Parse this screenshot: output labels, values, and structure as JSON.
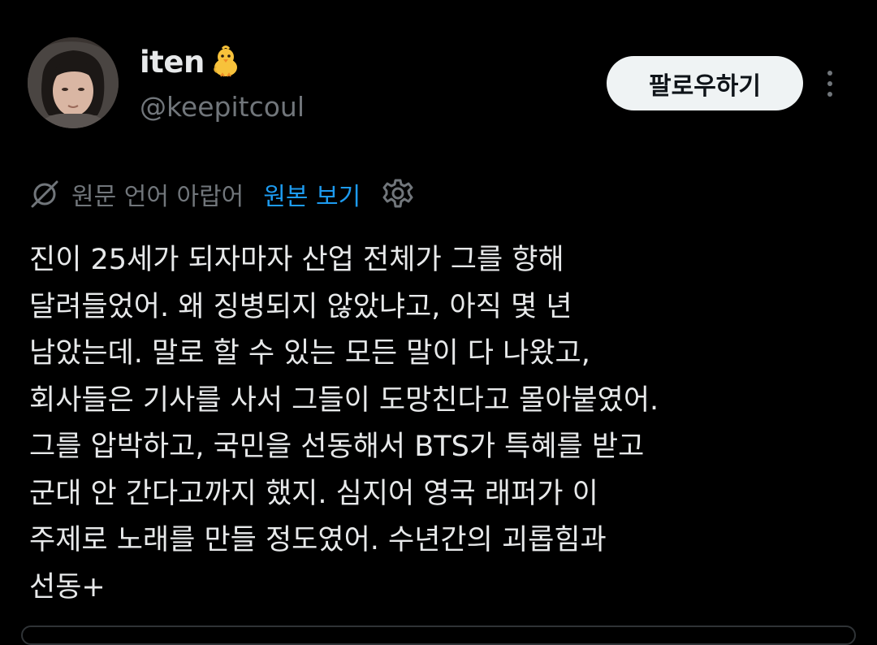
{
  "user": {
    "display_name": "iten",
    "emoji_icon": "baby-chick-icon",
    "handle": "@keepitcoul"
  },
  "actions": {
    "follow_label": "팔로우하기",
    "more_icon": "more-options-icon"
  },
  "translation": {
    "icon": "translate-icon",
    "label": "원문 언어 아랍어",
    "show_original": "원본 보기",
    "settings_icon": "gear-icon"
  },
  "tweet": {
    "lines": [
      "진이 25세가 되자마자 산업 전체가 그를 향해",
      "달려들었어. 왜 징병되지 않았냐고, 아직 몇 년",
      "남았는데. 말로 할 수 있는 모든 말이 다 나왔고,",
      "회사들은 기사를 사서 그들이 도망친다고 몰아붙였어.",
      "그를 압박하고, 국민을 선동해서 BTS가 특혜를 받고",
      "군대 안 간다고까지 했지. 심지어 영국 래퍼가 이",
      "주제로 노래를 만들 정도였어. 수년간의 괴롭힘과",
      "선동+"
    ]
  },
  "colors": {
    "background": "#000000",
    "text_primary": "#e7e9ea",
    "text_secondary": "#71767b",
    "link": "#1d9bf0",
    "button_bg": "#eff3f4"
  }
}
